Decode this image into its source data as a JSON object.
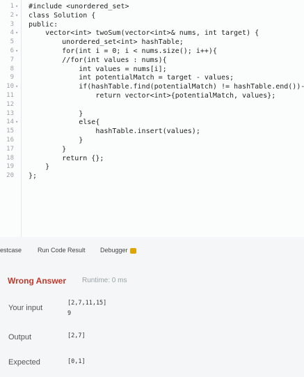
{
  "editor": {
    "lines": [
      {
        "n": "1",
        "fold": true,
        "text": "#include <unordered_set>"
      },
      {
        "n": "2",
        "fold": true,
        "text": "class Solution {"
      },
      {
        "n": "3",
        "fold": false,
        "text": "public:"
      },
      {
        "n": "4",
        "fold": true,
        "text": "    vector<int> twoSum(vector<int>& nums, int target) {"
      },
      {
        "n": "5",
        "fold": false,
        "text": "        unordered_set<int> hashTable;"
      },
      {
        "n": "6",
        "fold": true,
        "text": "        for(int i = 0; i < nums.size(); i++){"
      },
      {
        "n": "7",
        "fold": false,
        "text": "        //for(int values : nums){"
      },
      {
        "n": "8",
        "fold": false,
        "text": "            int values = nums[i];"
      },
      {
        "n": "9",
        "fold": false,
        "text": "            int potentialMatch = target - values;"
      },
      {
        "n": "10",
        "fold": true,
        "text": "            if(hashTable.find(potentialMatch) != hashTable.end())-"
      },
      {
        "n": "11",
        "fold": false,
        "text": "                return vector<int>{potentialMatch, values};"
      },
      {
        "n": "12",
        "fold": false,
        "text": ""
      },
      {
        "n": "13",
        "fold": false,
        "text": "            }"
      },
      {
        "n": "14",
        "fold": true,
        "text": "            else{"
      },
      {
        "n": "15",
        "fold": false,
        "text": "                hashTable.insert(values);"
      },
      {
        "n": "16",
        "fold": false,
        "text": "            }"
      },
      {
        "n": "17",
        "fold": false,
        "text": "        }"
      },
      {
        "n": "18",
        "fold": false,
        "text": "        return {};"
      },
      {
        "n": "19",
        "fold": false,
        "text": "    }"
      },
      {
        "n": "20",
        "fold": false,
        "text": "};"
      }
    ]
  },
  "tabs": {
    "testcase": "estcase",
    "run_code_result": "Run Code Result",
    "debugger": "Debugger"
  },
  "result": {
    "status": "Wrong Answer",
    "runtime": "Runtime: 0 ms",
    "your_input_label": "Your input",
    "your_input_line1": "[2,7,11,15]",
    "your_input_line2": "9",
    "output_label": "Output",
    "output_value": "[2,7]",
    "expected_label": "Expected",
    "expected_value": "[0,1]"
  },
  "colors": {
    "wrong_answer": "#c0392b",
    "keyword": "#1f3fbf",
    "debugger_icon": "#e0a400"
  },
  "icons": {
    "fold": "chevron-down-icon",
    "debugger": "bug-icon"
  }
}
